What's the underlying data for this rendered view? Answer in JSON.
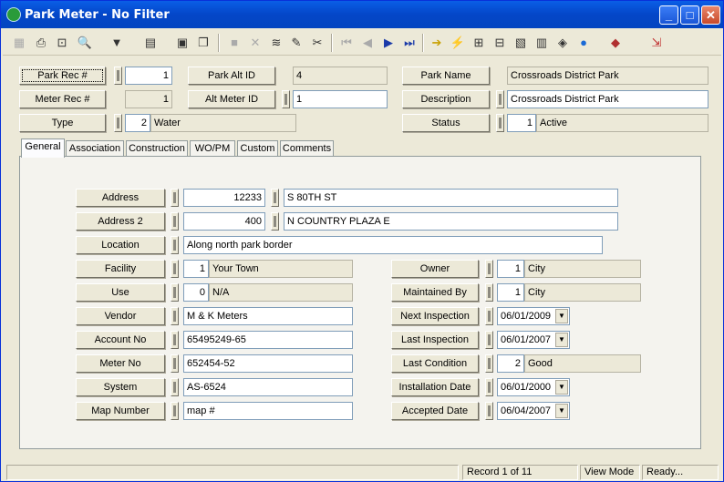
{
  "window": {
    "title": "Park Meter - No Filter"
  },
  "header": {
    "park_rec_label": "Park Rec #",
    "park_rec_value": "1",
    "park_alt_label": "Park Alt ID",
    "park_alt_value": "4",
    "park_name_label": "Park Name",
    "park_name_value": "Crossroads District Park",
    "meter_rec_label": "Meter Rec #",
    "meter_rec_value": "1",
    "alt_meter_label": "Alt Meter ID",
    "alt_meter_value": "1",
    "description_label": "Description",
    "description_value": "Crossroads District Park",
    "type_label": "Type",
    "type_code": "2",
    "type_value": "Water",
    "status_label": "Status",
    "status_code": "1",
    "status_value": "Active"
  },
  "tabs": [
    "General",
    "Association",
    "Construction",
    "WO/PM",
    "Custom",
    "Comments"
  ],
  "general": {
    "address_label": "Address",
    "address_no": "12233",
    "address_street": "S 80TH ST",
    "address2_label": "Address 2",
    "address2_no": "400",
    "address2_street": "N COUNTRY PLAZA E",
    "location_label": "Location",
    "location_value": "Along north park border",
    "facility_label": "Facility",
    "facility_code": "1",
    "facility_value": "Your Town",
    "use_label": "Use",
    "use_code": "0",
    "use_value": "N/A",
    "vendor_label": "Vendor",
    "vendor_value": "M & K Meters",
    "account_label": "Account No",
    "account_value": "65495249-65",
    "meter_no_label": "Meter No",
    "meter_no_value": "652454-52",
    "system_label": "System",
    "system_value": "AS-6524",
    "map_label": "Map Number",
    "map_value": "map #",
    "owner_label": "Owner",
    "owner_code": "1",
    "owner_value": "City",
    "maintained_label": "Maintained By",
    "maintained_code": "1",
    "maintained_value": "City",
    "next_insp_label": "Next Inspection",
    "next_insp_value": "06/01/2009",
    "last_insp_label": "Last Inspection",
    "last_insp_value": "06/01/2007",
    "last_cond_label": "Last Condition",
    "last_cond_code": "2",
    "last_cond_value": "Good",
    "install_label": "Installation Date",
    "install_value": "06/01/2000",
    "accepted_label": "Accepted Date",
    "accepted_value": "06/04/2007"
  },
  "status": {
    "record": "Record 1 of 11",
    "mode": "View Mode",
    "state": "Ready..."
  }
}
